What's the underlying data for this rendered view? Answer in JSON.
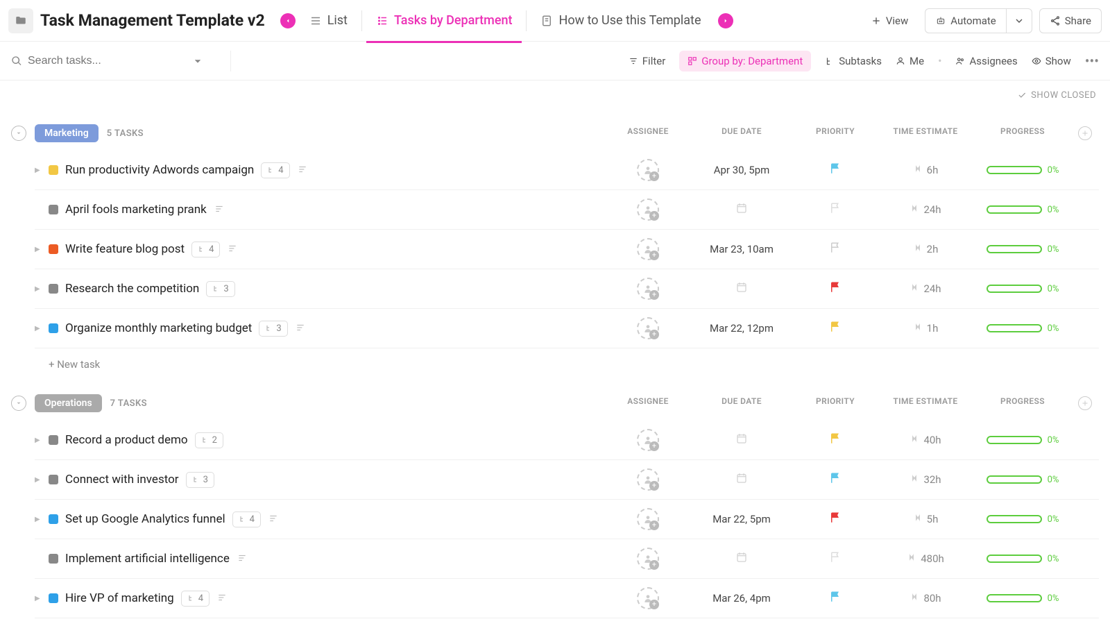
{
  "header": {
    "title": "Task Management Template v2",
    "tabs": [
      {
        "label": "List",
        "icon": "list"
      },
      {
        "label": "Tasks by Department",
        "icon": "list-pinned"
      },
      {
        "label": "How to Use this Template",
        "icon": "doc"
      }
    ],
    "add_view_label": "View",
    "automate_label": "Automate",
    "share_label": "Share"
  },
  "toolbar": {
    "search_placeholder": "Search tasks...",
    "filter_label": "Filter",
    "group_by_label": "Group by: Department",
    "subtasks_label": "Subtasks",
    "me_label": "Me",
    "assignees_label": "Assignees",
    "show_label": "Show"
  },
  "show_closed_label": "SHOW CLOSED",
  "columns": {
    "assignee": "ASSIGNEE",
    "due_date": "DUE DATE",
    "priority": "PRIORITY",
    "time_estimate": "TIME ESTIMATE",
    "progress": "PROGRESS"
  },
  "new_task_label": "+ New task",
  "groups": [
    {
      "name": "Marketing",
      "count_label": "5 TASKS",
      "badge_color": "#7d9bdb",
      "tasks": [
        {
          "expandable": true,
          "status_color": "#f2c744",
          "name": "Run productivity Adwords campaign",
          "subtasks": "4",
          "has_desc": true,
          "due": "Apr 30, 5pm",
          "flag": "#5ec6ea",
          "time": "6h",
          "progress": "0%"
        },
        {
          "expandable": false,
          "status_color": "#888",
          "name": "April fools marketing prank",
          "subtasks": null,
          "has_desc": true,
          "due": null,
          "flag": "#ddd",
          "time": "24h",
          "progress": "0%"
        },
        {
          "expandable": true,
          "status_color": "#ec5b24",
          "name": "Write feature blog post",
          "subtasks": "4",
          "has_desc": true,
          "due": "Mar 23, 10am",
          "flag": "#ccc",
          "time": "2h",
          "progress": "0%"
        },
        {
          "expandable": true,
          "status_color": "#888",
          "name": "Research the competition",
          "subtasks": "3",
          "has_desc": false,
          "due": null,
          "flag": "#e83a3a",
          "time": "24h",
          "progress": "0%"
        },
        {
          "expandable": true,
          "status_color": "#2ea0e8",
          "name": "Organize monthly marketing budget",
          "subtasks": "3",
          "has_desc": true,
          "due": "Mar 22, 12pm",
          "flag": "#f2c744",
          "time": "1h",
          "progress": "0%"
        }
      ]
    },
    {
      "name": "Operations",
      "count_label": "7 TASKS",
      "badge_color": "#aaa",
      "tasks": [
        {
          "expandable": true,
          "status_color": "#888",
          "name": "Record a product demo",
          "subtasks": "2",
          "has_desc": false,
          "due": null,
          "flag": "#f2c744",
          "time": "40h",
          "progress": "0%"
        },
        {
          "expandable": true,
          "status_color": "#888",
          "name": "Connect with investor",
          "subtasks": "3",
          "has_desc": false,
          "due": null,
          "flag": "#5ec6ea",
          "time": "32h",
          "progress": "0%"
        },
        {
          "expandable": true,
          "status_color": "#2ea0e8",
          "name": "Set up Google Analytics funnel",
          "subtasks": "4",
          "has_desc": true,
          "due": "Mar 22, 5pm",
          "flag": "#e83a3a",
          "time": "5h",
          "progress": "0%"
        },
        {
          "expandable": false,
          "status_color": "#888",
          "name": "Implement artificial intelligence",
          "subtasks": null,
          "has_desc": true,
          "due": null,
          "flag": "#ddd",
          "time": "480h",
          "progress": "0%"
        },
        {
          "expandable": true,
          "status_color": "#2ea0e8",
          "name": "Hire VP of marketing",
          "subtasks": "4",
          "has_desc": true,
          "due": "Mar 26, 4pm",
          "flag": "#5ec6ea",
          "time": "80h",
          "progress": "0%"
        }
      ]
    }
  ]
}
